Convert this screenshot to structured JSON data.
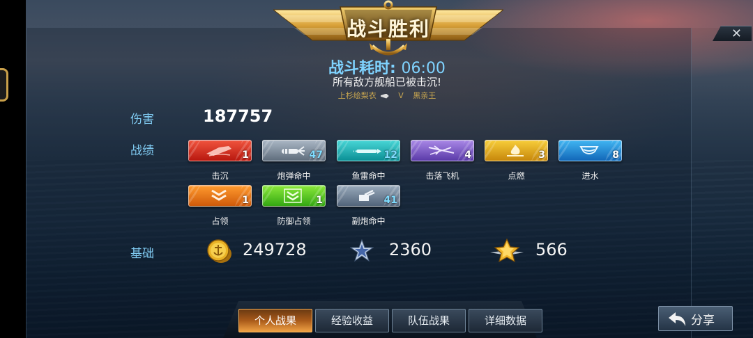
{
  "banner": {
    "title": "战斗胜利"
  },
  "battle": {
    "time_label": "战斗耗时:",
    "time_value": "06:00",
    "result_message": "所有敌方舰船已被击沉!",
    "player_left": "上杉绘梨衣",
    "vs": "V",
    "player_right": "黑亲王"
  },
  "labels": {
    "damage": "伤害",
    "achievements": "战绩",
    "basic": "基础"
  },
  "damage_value": "187757",
  "achievements": [
    {
      "name": "击沉",
      "count": "1",
      "color": "#d8301f",
      "icon": "ship-sink-icon"
    },
    {
      "name": "炮弹命中",
      "count": "47",
      "color": "#7f8d9c",
      "icon": "shell-hit-icon"
    },
    {
      "name": "鱼雷命中",
      "count": "12",
      "color": "#19b0b3",
      "icon": "torpedo-hit-icon"
    },
    {
      "name": "击落飞机",
      "count": "4",
      "color": "#7b5ac6",
      "icon": "plane-down-icon"
    },
    {
      "name": "点燃",
      "count": "3",
      "color": "#e3a51c",
      "icon": "fire-icon"
    },
    {
      "name": "进水",
      "count": "8",
      "color": "#2a8cd6",
      "icon": "flood-icon"
    },
    {
      "name": "占领",
      "count": "1",
      "color": "#ee7a1c",
      "icon": "capture-icon"
    },
    {
      "name": "防御占领",
      "count": "1",
      "color": "#5cca24",
      "icon": "defend-capture-icon"
    },
    {
      "name": "副炮命中",
      "count": "41",
      "color": "#748699",
      "icon": "secondary-gun-icon"
    }
  ],
  "basic": {
    "gold_value": "249728",
    "exp_value": "2360",
    "commander_exp_value": "566"
  },
  "tabs": [
    "个人战果",
    "经验收益",
    "队伍战果",
    "详细数据"
  ],
  "active_tab": 0,
  "share_label": "分享",
  "close_glyph": "✕"
}
